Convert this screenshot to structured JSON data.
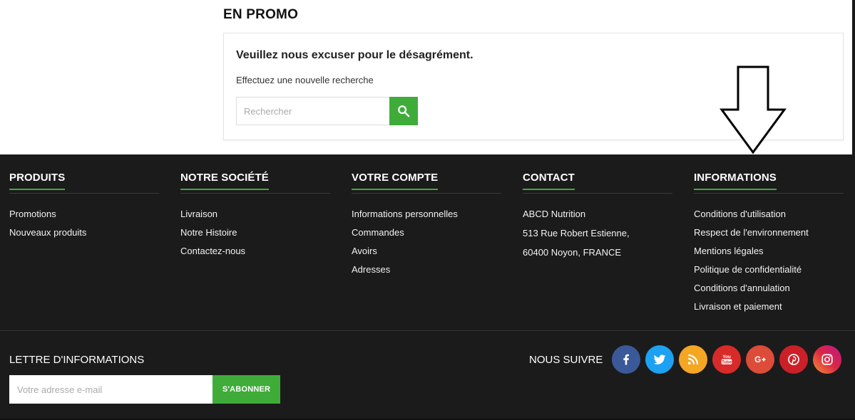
{
  "promo": {
    "title": "EN PROMO",
    "notice_title": "Veuillez nous excuser pour le désagrément.",
    "notice_sub": "Effectuez une nouvelle recherche",
    "search_placeholder": "Rechercher",
    "search_icon": "search-icon"
  },
  "footer": {
    "columns": [
      {
        "title": "PRODUITS",
        "items": [
          "Promotions",
          "Nouveaux produits"
        ]
      },
      {
        "title": "NOTRE SOCIÉTÉ",
        "items": [
          "Livraison",
          "Notre Histoire",
          "Contactez-nous"
        ]
      },
      {
        "title": "VOTRE COMPTE",
        "items": [
          "Informations personnelles",
          "Commandes",
          "Avoirs",
          "Adresses"
        ]
      },
      {
        "title": "CONTACT",
        "items": [
          "ABCD Nutrition",
          "513 Rue Robert Estienne,",
          "60400 Noyon, FRANCE"
        ]
      },
      {
        "title": "INFORMATIONS",
        "items": [
          "Conditions d'utilisation",
          "Respect de l'environnement",
          "Mentions légales",
          "Politique de confidentialité",
          "Conditions d'annulation",
          "Livraison et paiement"
        ]
      }
    ],
    "newsletter": {
      "title": "LETTRE D'INFORMATIONS",
      "placeholder": "Votre adresse e-mail",
      "button": "S'ABONNER"
    },
    "follow_label": "NOUS SUIVRE",
    "socials": [
      {
        "name": "facebook-icon",
        "color": "#3b5998"
      },
      {
        "name": "twitter-icon",
        "color": "#1da1f2"
      },
      {
        "name": "rss-icon",
        "color": "#f5a623"
      },
      {
        "name": "youtube-icon",
        "color": "#d92a2a"
      },
      {
        "name": "google-plus-icon",
        "color": "#dd4b39"
      },
      {
        "name": "pinterest-icon",
        "color": "#cb2027"
      },
      {
        "name": "instagram-icon",
        "color": "#c13584"
      }
    ]
  },
  "colors": {
    "accent": "#3fac3a",
    "footer_bg": "#1b1b1b"
  }
}
